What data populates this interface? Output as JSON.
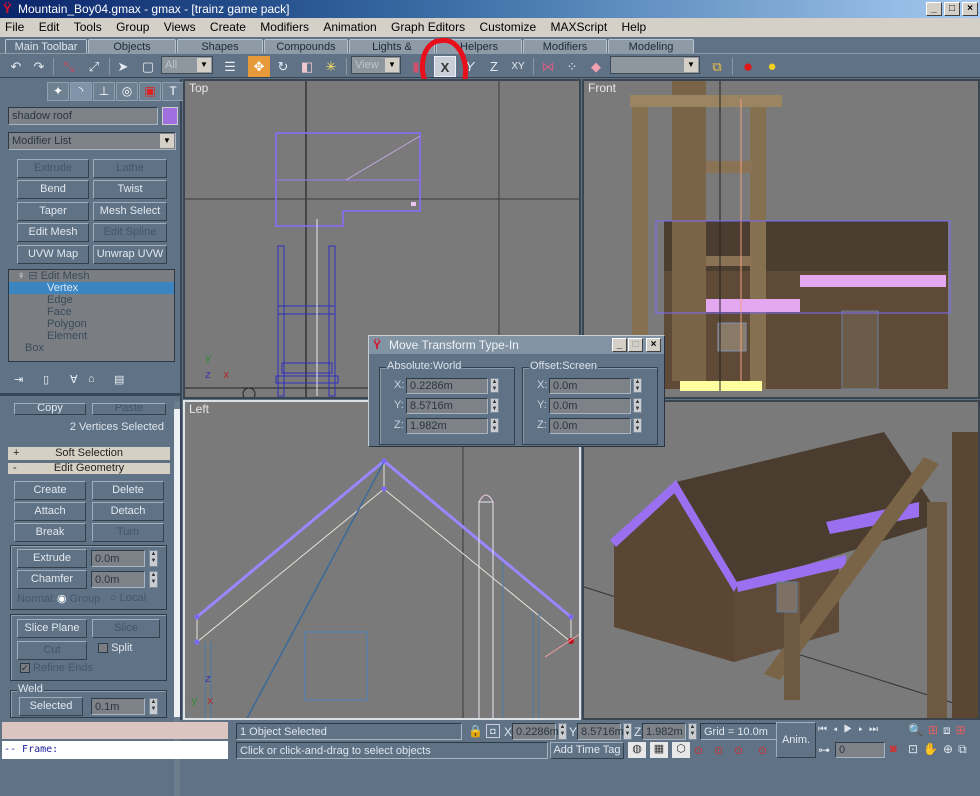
{
  "window": {
    "title": "Mountain_Boy04.gmax - gmax - [trainz game pack]",
    "controls": [
      "_",
      "□",
      "×"
    ]
  },
  "menu": [
    "File",
    "Edit",
    "Tools",
    "Group",
    "Views",
    "Create",
    "Modifiers",
    "Animation",
    "Graph Editors",
    "Customize",
    "MAXScript",
    "Help"
  ],
  "tabs": [
    {
      "label": "Main Toolbar",
      "active": true
    },
    {
      "label": "Objects"
    },
    {
      "label": "Shapes"
    },
    {
      "label": "Compounds"
    },
    {
      "label": "Lights & Cameras"
    },
    {
      "label": "Helpers"
    },
    {
      "label": "Modifiers"
    },
    {
      "label": "Modeling"
    }
  ],
  "toolbar": {
    "icons": [
      "undo-icon",
      "redo-icon",
      "link-icon",
      "unlink-icon",
      "select-arrow-icon",
      "region-select-icon",
      "select-by-name-icon",
      "move-icon",
      "rotate-icon",
      "scale-icon",
      "pivot-icon",
      "transform-gizmo-icon",
      "restrict-x-icon",
      "restrict-y-icon",
      "restrict-z-icon",
      "restrict-xy-icon",
      "mirror-icon",
      "align-icon",
      "named-selection-icon",
      "layers-icon",
      "render-icon",
      "material-icon"
    ],
    "selection_filter": "All",
    "reference_coord": "View",
    "named_selection": "",
    "restrict_x_label": "X",
    "restrict_y_label": "Y",
    "restrict_z_label": "Z",
    "restrict_xy_label": "XY",
    "annotation_color": "#e8101a"
  },
  "command_panel": {
    "object_name": "shadow roof",
    "object_color": "#a070e0",
    "modifier_list": "Modifier List",
    "modifier_buttons": [
      {
        "label": "Extrude",
        "disabled": true
      },
      {
        "label": "Lathe",
        "disabled": true
      },
      {
        "label": "Bend"
      },
      {
        "label": "Twist"
      },
      {
        "label": "Taper"
      },
      {
        "label": "Mesh Select"
      },
      {
        "label": "Edit Mesh"
      },
      {
        "label": "Edit Spline",
        "disabled": true
      },
      {
        "label": "UVW Map"
      },
      {
        "label": "Unwrap UVW"
      }
    ],
    "stack": [
      {
        "label": "Edit Mesh",
        "level": 0
      },
      {
        "label": "Vertex",
        "level": 1,
        "selected": true
      },
      {
        "label": "Edge",
        "level": 1
      },
      {
        "label": "Face",
        "level": 1
      },
      {
        "label": "Polygon",
        "level": 1
      },
      {
        "label": "Element",
        "level": 1
      },
      {
        "label": "Box",
        "level": 0
      }
    ],
    "copy_label": "Copy",
    "paste_label": "Paste",
    "selection_status": "2 Vertices Selected",
    "soft_selection": {
      "label": "Soft Selection",
      "sign": "+"
    },
    "edit_geometry": {
      "label": "Edit Geometry",
      "sign": "-",
      "buttons": [
        {
          "label": "Create"
        },
        {
          "label": "Delete"
        },
        {
          "label": "Attach"
        },
        {
          "label": "Detach"
        },
        {
          "label": "Break"
        },
        {
          "label": "Turn",
          "disabled": true
        }
      ],
      "extrude": {
        "label": "Extrude",
        "value": "0.0m"
      },
      "chamfer": {
        "label": "Chamfer",
        "value": "0.0m"
      },
      "normal_label": "Normal:",
      "normal_options": [
        {
          "label": "Group",
          "checked": true
        },
        {
          "label": "Local",
          "checked": false
        }
      ],
      "slice_plane": "Slice Plane",
      "slice": "Slice",
      "cut": "Cut",
      "split": {
        "label": "Split",
        "checked": false
      },
      "refine_ends": {
        "label": "Refine Ends",
        "checked": true
      },
      "weld": {
        "label": "Weld",
        "selected_btn": "Selected",
        "value": "0.1m"
      }
    }
  },
  "viewports": {
    "top": {
      "label": "Top"
    },
    "front": {
      "label": "Front"
    },
    "left": {
      "label": "Left"
    },
    "perspective": {
      "label": ""
    }
  },
  "dialog": {
    "title": "Move Transform Type-In",
    "absolute": {
      "label": "Absolute:World",
      "x": "0.2286m",
      "y": "8.5716m",
      "z": "1.982m"
    },
    "offset": {
      "label": "Offset:Screen",
      "x": "0.0m",
      "y": "0.0m",
      "z": "0.0m"
    },
    "axis": {
      "x": "X:",
      "y": "Y:",
      "z": "Z:"
    }
  },
  "maxscript": {
    "output": "",
    "prompt": "-- Frame:"
  },
  "status": {
    "selection": "1 Object Selected",
    "prompt": "Click or click-and-drag to select objects",
    "x": "0.2286m",
    "y": "8.5716m",
    "z": "1.982m",
    "x_label": "X",
    "y_label": "Y",
    "z_label": "Z",
    "grid": "Grid = 10.0m",
    "add_time_tag": "Add Time Tag",
    "anim": "Anim.",
    "frame": "0"
  }
}
